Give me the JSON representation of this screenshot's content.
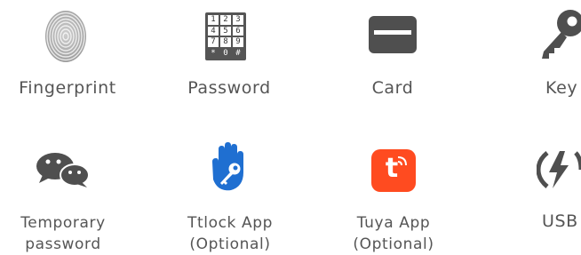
{
  "features": [
    {
      "label": "Fingerprint",
      "icon": "fingerprint-icon"
    },
    {
      "label": "Password",
      "icon": "keypad-icon",
      "keypad": [
        "1",
        "2",
        "3",
        "4",
        "5",
        "6",
        "7",
        "8",
        "9",
        "*",
        "0",
        "#"
      ]
    },
    {
      "label": "Card",
      "icon": "card-icon"
    },
    {
      "label": "Key",
      "icon": "key-icon"
    },
    {
      "label_lines": [
        "Temporary",
        "password"
      ],
      "icon": "chat-bubbles-icon"
    },
    {
      "label_lines": [
        "Ttlock App",
        "(Optional)"
      ],
      "icon": "ttlock-hand-key-icon"
    },
    {
      "label_lines": [
        "Tuya App",
        "(Optional)"
      ],
      "icon": "tuya-app-icon",
      "icon_letter": "t"
    },
    {
      "label": "USB",
      "icon": "usb-power-icon"
    }
  ],
  "colors": {
    "text": "#555555",
    "icon_gray": "#4f4f4f",
    "ttlock_blue": "#1f6fd1",
    "tuya_orange": "#ff4b20"
  }
}
